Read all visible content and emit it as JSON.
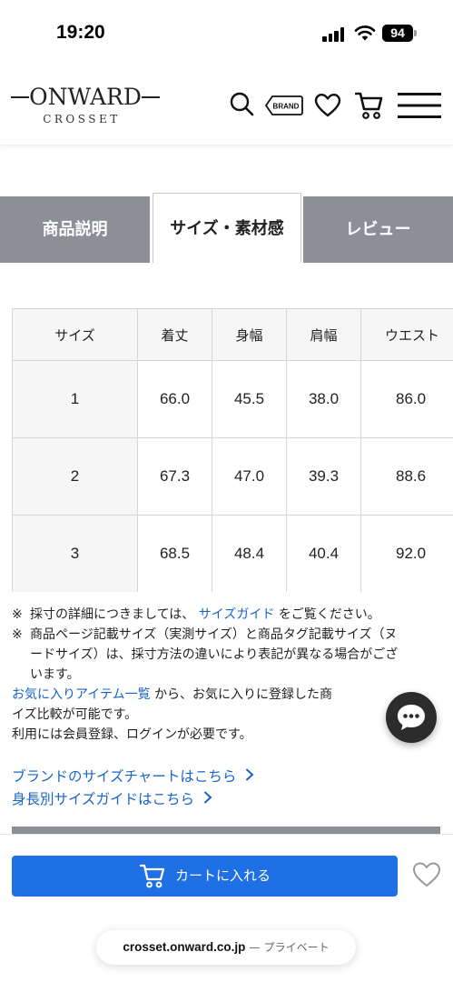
{
  "status_bar": {
    "time": "19:20",
    "battery": "94"
  },
  "header": {
    "logo_main": "ONWARD",
    "logo_sub": "CROSSET",
    "brand_icon_label": "BRAND",
    "icons": [
      "search-icon",
      "brand-icon",
      "heart-icon",
      "cart-icon",
      "menu-icon"
    ]
  },
  "tabs": [
    {
      "label": "商品説明",
      "active": false
    },
    {
      "label": "サイズ・素材感",
      "active": true
    },
    {
      "label": "レビュー",
      "active": false
    }
  ],
  "size_table": {
    "headers": [
      "サイズ",
      "着丈",
      "身幅",
      "肩幅",
      "ウエスト"
    ],
    "rows": [
      [
        "1",
        "66.0",
        "45.5",
        "38.0",
        "86.0"
      ],
      [
        "2",
        "67.3",
        "47.0",
        "39.3",
        "88.6"
      ],
      [
        "3",
        "68.5",
        "48.4",
        "40.4",
        "92.0"
      ]
    ]
  },
  "notes": {
    "note1_mark": "※",
    "note1_prefix": "採寸の詳細につきましては、",
    "note1_link": "サイズガイド",
    "note1_suffix": "をご覧ください。",
    "note2_mark": "※",
    "note2_line1": "商品ページ記載サイズ（実測サイズ）と商品タグ記載サイズ（ヌ",
    "note2_line2": "ードサイズ）は、採寸方法の違いにより表記が異なる場合がござ",
    "note2_line3": "います。",
    "fav_link": "お気に入りアイテム一覧",
    "fav_text1": "から、お気に入りに登録した商",
    "fav_text2": "イズ比較が可能です。",
    "fav_text3": "利用には会員登録、ログインが必要です。"
  },
  "links": {
    "brand_size_chart": "ブランドのサイズチャートはこちら",
    "height_size_guide": "身長別サイズガイドはこちら"
  },
  "bottom": {
    "cart_label": "カートに入れる",
    "url_host": "crosset.onward.co.jp",
    "url_sep": "—",
    "url_mode": "プライベート"
  },
  "colors": {
    "accent_blue": "#1f6fe5",
    "link_blue": "#1a64c8",
    "tab_gray": "#8c8f95",
    "table_header_bg": "#f6f6f6"
  }
}
